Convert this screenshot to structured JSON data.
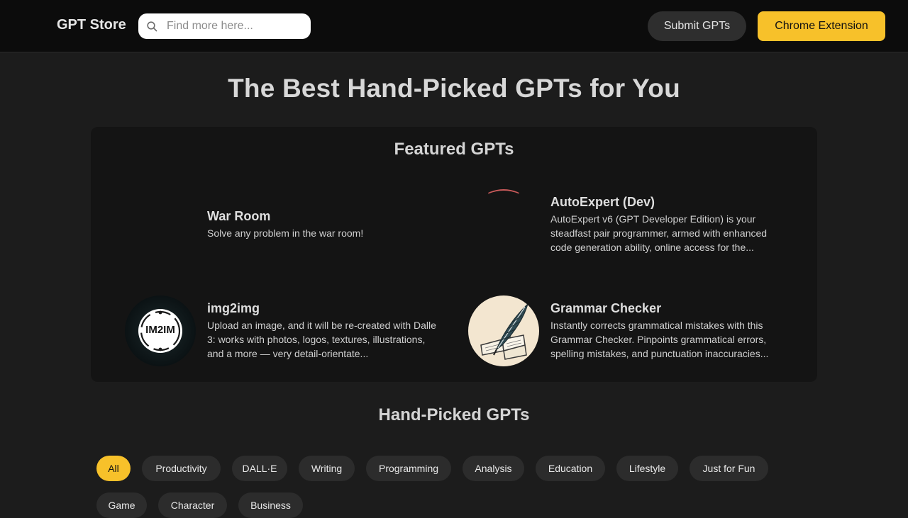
{
  "header": {
    "logo": "GPT Store",
    "search_placeholder": "Find more here...",
    "submit_label": "Submit GPTs",
    "chrome_label": "Chrome Extension"
  },
  "hero": {
    "title": "The Best Hand-Picked GPTs for You"
  },
  "featured": {
    "title": "Featured GPTs",
    "items": [
      {
        "name": "War Room",
        "desc": "Solve any problem in the war room!"
      },
      {
        "name": "AutoExpert (Dev)",
        "desc": "AutoExpert v6 (GPT Developer Edition) is your steadfast pair programmer, armed with enhanced code generation ability, online access for the..."
      },
      {
        "name": "img2img",
        "desc": "Upload an image, and it will be re-created with Dalle 3: works with photos, logos, textures, illustrations, and a more — very detail-orientate...",
        "logo_text": "IM2IM"
      },
      {
        "name": "Grammar Checker",
        "desc": "Instantly corrects grammatical mistakes with this Grammar Checker. Pinpoints grammatical errors, spelling mistakes, and punctuation inaccuracies..."
      }
    ]
  },
  "handpicked": {
    "title": "Hand-Picked GPTs",
    "categories": [
      "All",
      "Productivity",
      "DALL·E",
      "Writing",
      "Programming",
      "Analysis",
      "Education",
      "Lifestyle",
      "Just for Fun",
      "Game",
      "Character",
      "Business"
    ],
    "active": "All"
  },
  "colors": {
    "accent": "#f7c12a",
    "background": "#1c1c1c",
    "topbar": "#0c0c0c",
    "panel": "#141414"
  }
}
